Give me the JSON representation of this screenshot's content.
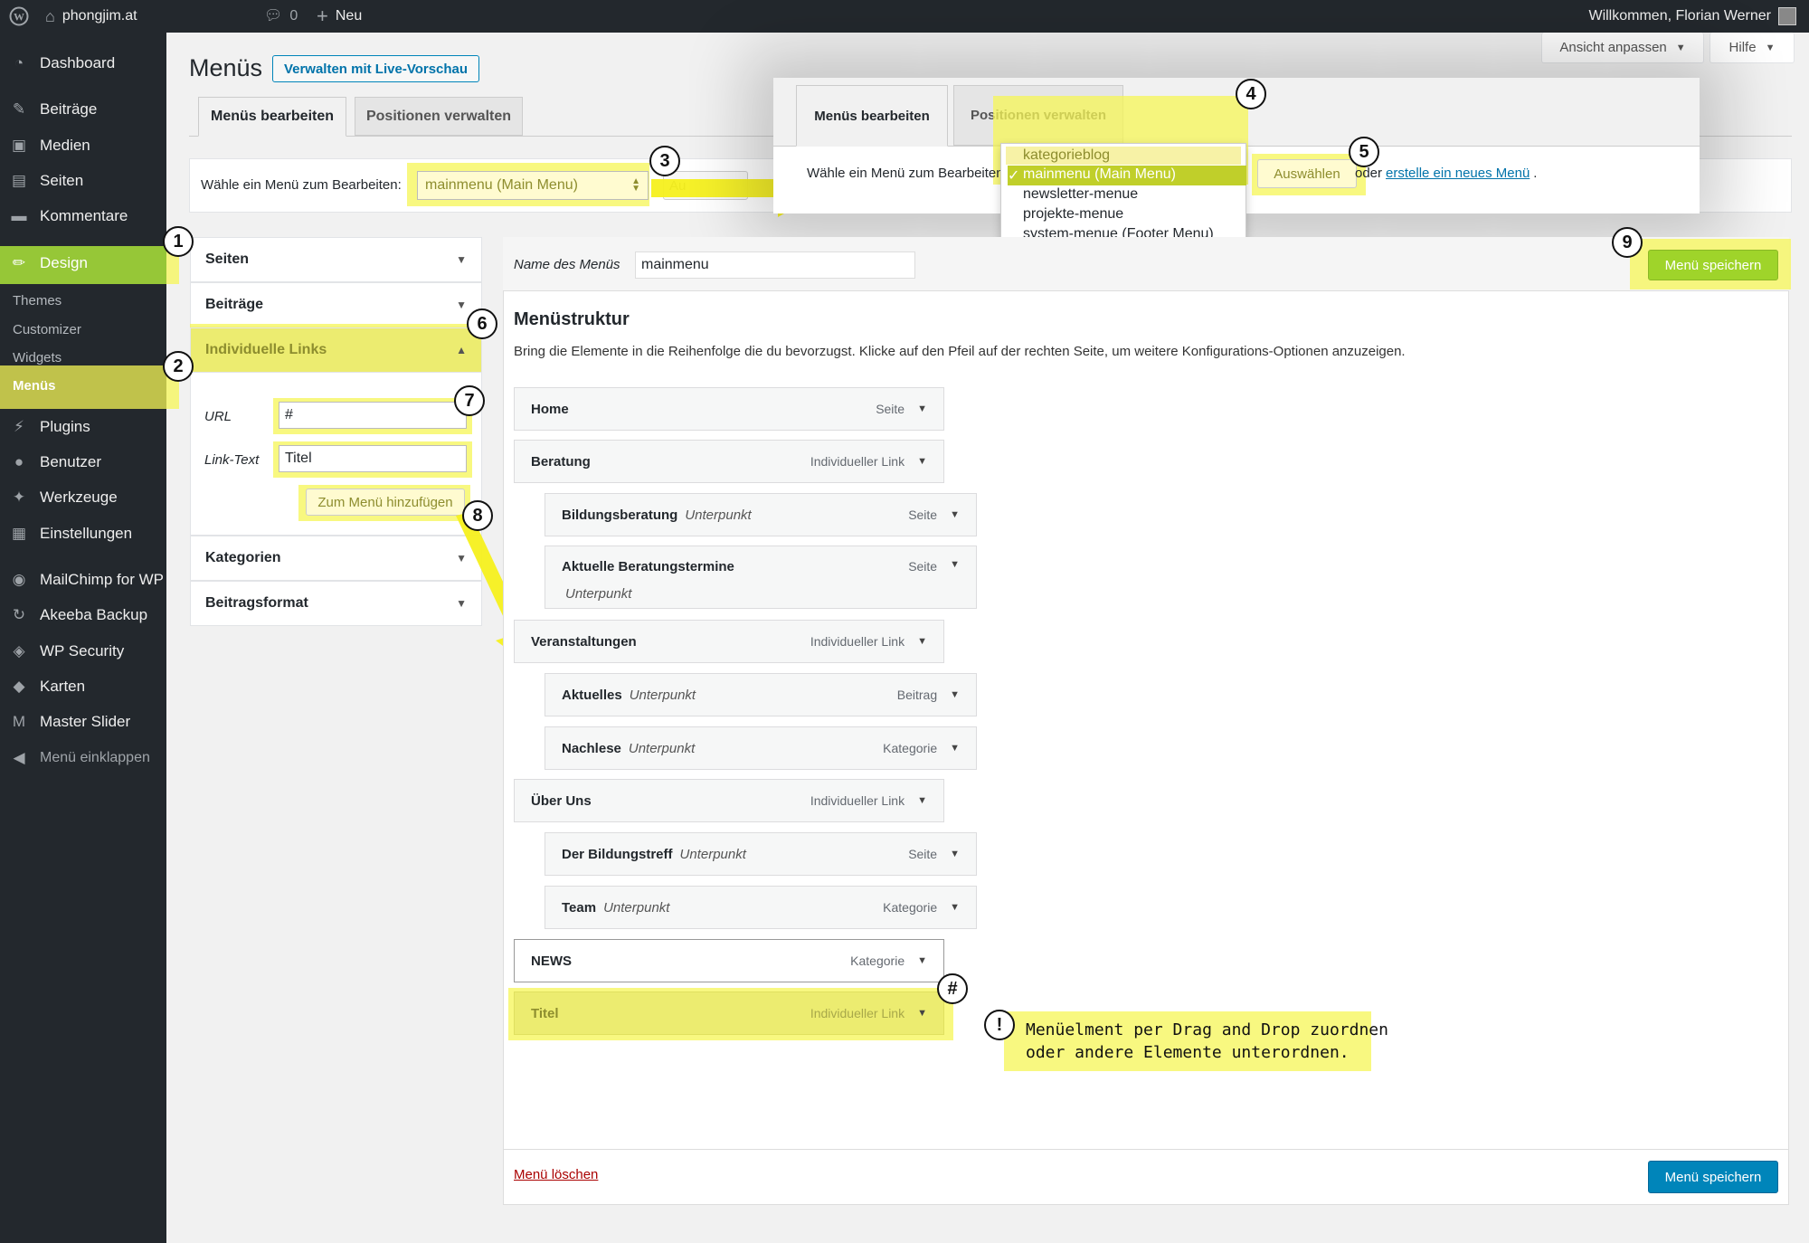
{
  "adminbar": {
    "site": "phongjim.at",
    "comments": "0",
    "new": "Neu",
    "greeting": "Willkommen, Florian Werner"
  },
  "sidebar": {
    "items": [
      {
        "label": "Dashboard",
        "icon": "dashboard-icon"
      },
      {
        "label": "Beiträge",
        "icon": "pin-icon"
      },
      {
        "label": "Medien",
        "icon": "media-icon"
      },
      {
        "label": "Seiten",
        "icon": "pages-icon"
      },
      {
        "label": "Kommentare",
        "icon": "comment-icon"
      },
      {
        "label": "Design",
        "icon": "brush-icon"
      },
      {
        "label": "Plugins",
        "icon": "plug-icon"
      },
      {
        "label": "Benutzer",
        "icon": "user-icon"
      },
      {
        "label": "Werkzeuge",
        "icon": "wrench-icon"
      },
      {
        "label": "Einstellungen",
        "icon": "settings-icon"
      },
      {
        "label": "MailChimp for WP",
        "icon": "mailchimp-icon"
      },
      {
        "label": "Akeeba Backup",
        "icon": "backup-icon"
      },
      {
        "label": "WP Security",
        "icon": "shield-icon"
      },
      {
        "label": "Karten",
        "icon": "map-icon"
      },
      {
        "label": "Master Slider",
        "icon": "slider-icon"
      },
      {
        "label": "Menü einklappen",
        "icon": "collapse-icon"
      }
    ],
    "submenu": [
      "Themes",
      "Customizer",
      "Widgets",
      "Menüs"
    ]
  },
  "screen": {
    "options": "Ansicht anpassen",
    "help": "Hilfe"
  },
  "page": {
    "title": "Menüs",
    "live_preview": "Verwalten mit Live-Vorschau"
  },
  "tabs": {
    "edit": "Menüs bearbeiten",
    "locations": "Positionen verwalten"
  },
  "select_bar": {
    "label": "Wähle ein Menü zum Bearbeiten:",
    "selected": "mainmenu (Main Menu)",
    "button_partial": "Au"
  },
  "popup": {
    "tab_edit": "Menüs bearbeiten",
    "tab_locations": "Positionen verwalten",
    "label": "Wähle ein Menü zum Bearbeiten",
    "options": [
      "kategorieblog",
      "mainmenu (Main Menu)",
      "newsletter-menue",
      "projekte-menue",
      "system-menue (Footer Menu)"
    ],
    "checkmark": "✓",
    "select_button": "Auswählen",
    "or": "oder",
    "create_link": "erstelle ein neues Menü",
    "period": "."
  },
  "accordion": {
    "pages": "Seiten",
    "posts": "Beiträge",
    "custom_links": "Individuelle Links",
    "url_label": "URL",
    "url_value": "#",
    "linktext_label": "Link-Text",
    "linktext_value": "Titel",
    "add_button": "Zum Menü hinzufügen",
    "categories": "Kategorien",
    "post_format": "Beitragsformat"
  },
  "editor": {
    "name_label": "Name des Menüs",
    "name_value": "mainmenu",
    "save": "Menü speichern",
    "structure_title": "Menüstruktur",
    "structure_desc": "Bring die Elemente in die Reihenfolge die du bevorzugst. Klicke auf den Pfeil auf der rechten Seite, um weitere Konfigurations-Optionen anzuzeigen.",
    "delete": "Menü löschen",
    "save_bottom": "Menü speichern"
  },
  "menu_items": [
    {
      "title": "Home",
      "sub": "",
      "type": "Seite"
    },
    {
      "title": "Beratung",
      "sub": "",
      "type": "Individueller Link"
    },
    {
      "title": "Bildungsberatung",
      "sub": "Unterpunkt",
      "type": "Seite"
    },
    {
      "title": "Aktuelle Beratungstermine",
      "sub": "Unterpunkt",
      "type": "Seite"
    },
    {
      "title": "Veranstaltungen",
      "sub": "",
      "type": "Individueller Link"
    },
    {
      "title": "Aktuelles",
      "sub": "Unterpunkt",
      "type": "Beitrag"
    },
    {
      "title": "Nachlese",
      "sub": "Unterpunkt",
      "type": "Kategorie"
    },
    {
      "title": "Über Uns",
      "sub": "",
      "type": "Individueller Link"
    },
    {
      "title": "Der Bildungstreff",
      "sub": "Unterpunkt",
      "type": "Seite"
    },
    {
      "title": "Team",
      "sub": "Unterpunkt",
      "type": "Kategorie"
    },
    {
      "title": "NEWS",
      "sub": "",
      "type": "Kategorie"
    },
    {
      "title": "Titel",
      "sub": "",
      "type": "Individueller Link"
    }
  ],
  "annotations": {
    "badges": [
      "1",
      "2",
      "3",
      "4",
      "5",
      "6",
      "7",
      "8",
      "9",
      "#"
    ],
    "note_icon": "!",
    "note_line1": "Menüelment per Drag and Drop zuordnen",
    "note_line2": "oder andere Elemente unterordnen."
  },
  "colors": {
    "admin_bg": "#23282d",
    "wp_blue": "#0085ba",
    "green_save": "#9fd42a",
    "highlight": "#f5f555"
  }
}
